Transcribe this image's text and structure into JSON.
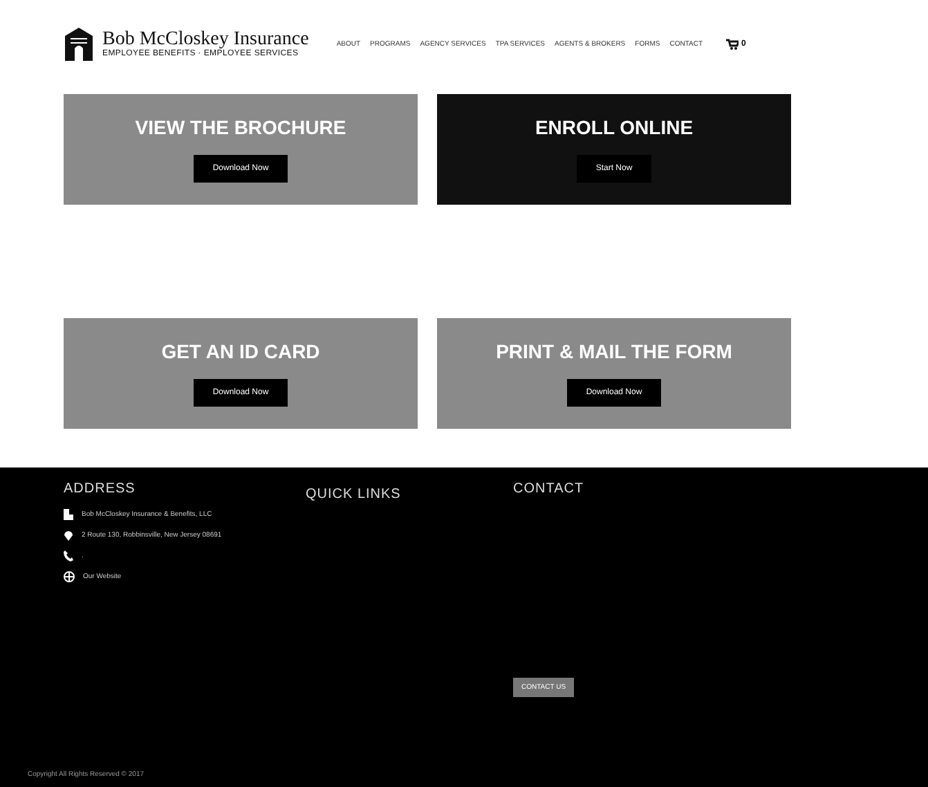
{
  "header": {
    "logo_title": "Bob McCloskey Insurance",
    "logo_tagline": "EMPLOYEE BENEFITS · EMPLOYEE SERVICES",
    "nav": [
      "ABOUT",
      "PROGRAMS",
      "AGENCY SERVICES",
      "TPA SERVICES",
      "AGENTS & BROKERS",
      "FORMS",
      "CONTACT"
    ],
    "cart_count": "0"
  },
  "cards": [
    {
      "title": "VIEW THE BROCHURE",
      "button": "Download Now",
      "kind": "grey"
    },
    {
      "title": "ENROLL ONLINE",
      "button": "Start Now",
      "kind": "dark"
    },
    {
      "title": "GET AN ID CARD",
      "button": "Download Now",
      "kind": "grey"
    },
    {
      "title": "PRINT & MAIL THE FORM",
      "button": "Download Now",
      "kind": "grey"
    }
  ],
  "footer": {
    "columns": [
      "ADDRESS",
      "QUICK LINKS",
      "CONTACT"
    ],
    "address": [
      {
        "kind": "building",
        "text": "Bob McCloskey Insurance & Benefits, LLC"
      },
      {
        "kind": "pin",
        "text": "2 Route 130, Robbinsville, New Jersey 08691"
      },
      {
        "kind": "phone",
        "text": "."
      },
      {
        "kind": "globe",
        "text": "Our Website"
      }
    ],
    "button": "CONTACT US",
    "copyright": "Copyright All Rights Reserved © 2017"
  }
}
